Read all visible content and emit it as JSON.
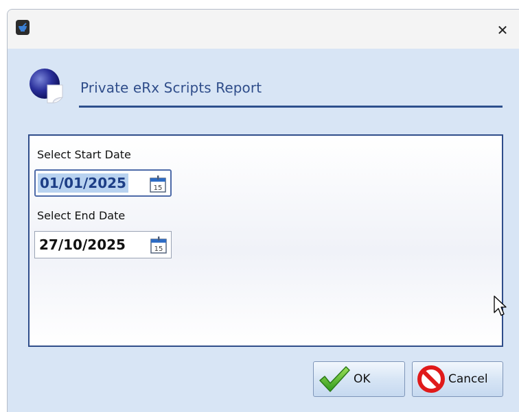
{
  "window": {
    "close_glyph": "✕"
  },
  "header": {
    "title": "Private eRx Scripts Report"
  },
  "form": {
    "start_date": {
      "label": "Select Start Date",
      "value": "01/01/2025",
      "calendar_day": "15"
    },
    "end_date": {
      "label": "Select End Date",
      "value": "27/10/2025",
      "calendar_day": "15"
    }
  },
  "buttons": {
    "ok_label": "OK",
    "cancel_label": "Cancel"
  },
  "colors": {
    "accent": "#2f4d8a",
    "dialog_background": "#d8e5f5",
    "selection": "#b8d2f0"
  }
}
